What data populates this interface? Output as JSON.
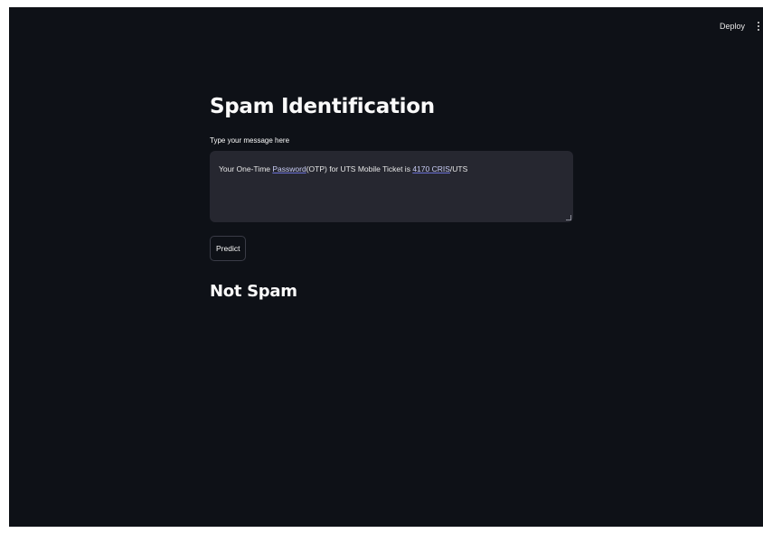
{
  "toolbar": {
    "deploy_label": "Deploy",
    "menu_icon": "vertical-ellipsis-icon"
  },
  "main": {
    "title": "Spam Identification",
    "input_label": "Type your message here",
    "message": {
      "part1": "Your One-Time ",
      "word_password": "Password",
      "part2": "(OTP) for UTS Mobile Ticket is ",
      "number": "4170",
      "space": " ",
      "cris": "CRIS",
      "part3": "/UTS"
    },
    "predict_label": "Predict",
    "result": "Not Spam"
  },
  "colors": {
    "background": "#0e1117",
    "textarea": "#262730",
    "text": "#fafafa",
    "decoration": "#b3322e"
  }
}
